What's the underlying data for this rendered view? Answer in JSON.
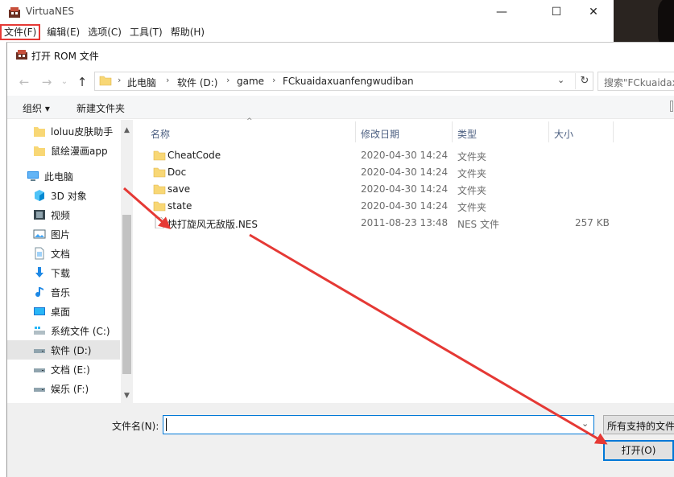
{
  "app": {
    "title": "VirtuaNES",
    "menu": [
      "文件(F)",
      "编辑(E)",
      "选项(C)",
      "工具(T)",
      "帮助(H)"
    ],
    "controls": {
      "minimize": "—",
      "maximize": "☐",
      "close": "✕"
    }
  },
  "dialog": {
    "title": "打开 ROM 文件",
    "breadcrumb": [
      "此电脑",
      "软件 (D:)",
      "game",
      "FCkuaidaxuanfengwudiban"
    ],
    "search_placeholder": "搜索\"FCkuaidax",
    "toolbar": {
      "organize": "组织 ▾",
      "new_folder": "新建文件夹"
    },
    "nav_items": [
      {
        "label": "loluu皮肤助手",
        "icon": "folder-icon"
      },
      {
        "label": "鼠绘漫画app",
        "icon": "folder-icon"
      },
      {
        "label": "此电脑",
        "icon": "computer-icon"
      },
      {
        "label": "3D 对象",
        "icon": "cube-icon"
      },
      {
        "label": "视频",
        "icon": "video-icon"
      },
      {
        "label": "图片",
        "icon": "picture-icon"
      },
      {
        "label": "文档",
        "icon": "document-icon"
      },
      {
        "label": "下载",
        "icon": "download-icon"
      },
      {
        "label": "音乐",
        "icon": "music-icon"
      },
      {
        "label": "桌面",
        "icon": "desktop-icon"
      },
      {
        "label": "系统文件 (C:)",
        "icon": "system-drive-icon"
      },
      {
        "label": "软件 (D:)",
        "icon": "drive-icon"
      },
      {
        "label": "文档 (E:)",
        "icon": "drive-icon"
      },
      {
        "label": "娱乐 (F:)",
        "icon": "drive-icon"
      }
    ],
    "columns": {
      "name": "名称",
      "modified": "修改日期",
      "type": "类型",
      "size": "大小"
    },
    "files": [
      {
        "name": "CheatCode",
        "modified": "2020-04-30 14:24",
        "type": "文件夹",
        "size": ""
      },
      {
        "name": "Doc",
        "modified": "2020-04-30 14:24",
        "type": "文件夹",
        "size": ""
      },
      {
        "name": "save",
        "modified": "2020-04-30 14:24",
        "type": "文件夹",
        "size": ""
      },
      {
        "name": "state",
        "modified": "2020-04-30 14:24",
        "type": "文件夹",
        "size": ""
      },
      {
        "name": "快打旋风无敌版.NES",
        "modified": "2011-08-23 13:48",
        "type": "NES 文件",
        "size": "257 KB"
      }
    ],
    "filename_label": "文件名(N):",
    "filename_value": "",
    "filter": "所有支持的文件",
    "open_button": "打开(O)"
  },
  "colors": {
    "accent": "#0078d7",
    "annotation": "#e53935",
    "folder": "#f8d775"
  }
}
